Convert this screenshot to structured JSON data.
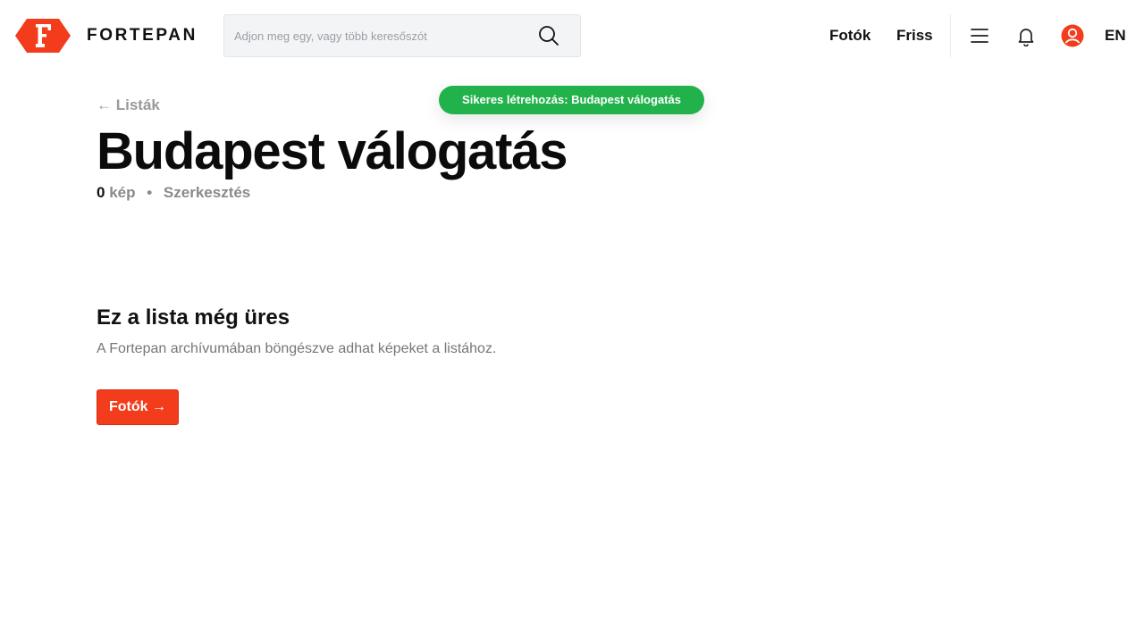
{
  "header": {
    "brand": "FORTEPAN",
    "search": {
      "placeholder": "Adjon meg egy, vagy több keresőszót",
      "value": ""
    },
    "nav": {
      "photos": "Fotók",
      "fresh": "Friss"
    },
    "icons": [
      "search-icon",
      "menu-icon",
      "bell-icon",
      "user-icon"
    ],
    "lang": "EN"
  },
  "toast": {
    "text": "Sikeres létrehozás: Budapest válogatás"
  },
  "page": {
    "back_label": "← Listák",
    "title": "Budapest válogatás",
    "count": "0",
    "count_unit": "kép",
    "separator": "•",
    "edit_label": "Szerkesztés"
  },
  "empty": {
    "title": "Ez a lista még üres",
    "description": "A Fortepan archívumában böngészve adhat képeket a listához.",
    "cta_label": "Fotók →"
  },
  "colors": {
    "brand": "#f23c1c",
    "toast": "#22b24c",
    "muted": "#9a9a9a"
  }
}
